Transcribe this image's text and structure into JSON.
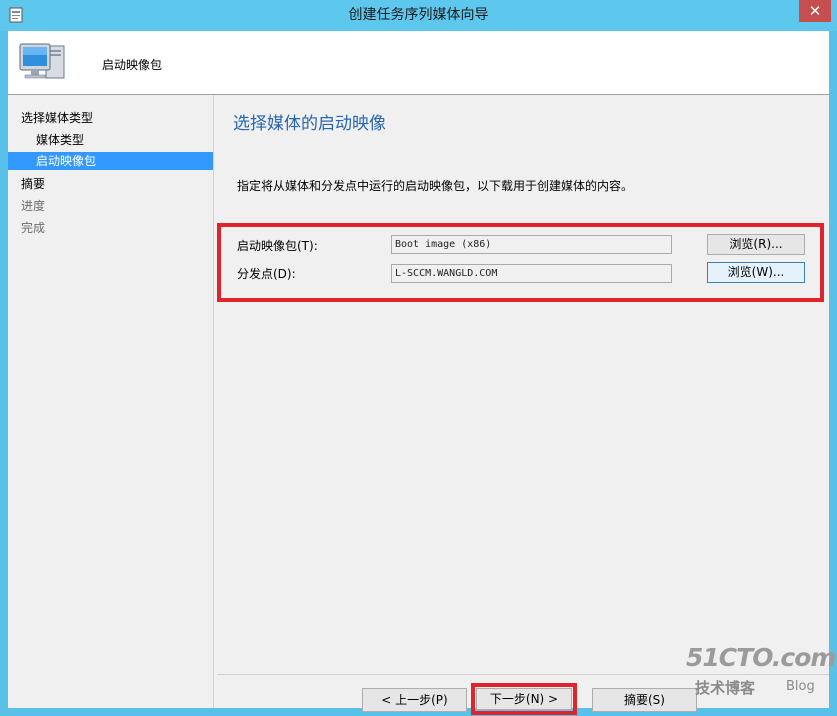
{
  "window": {
    "title": "创建任务序列媒体向导",
    "close_glyph": "✕"
  },
  "header": {
    "title": "启动映像包",
    "icon": "computer-icon"
  },
  "sidebar": {
    "items": [
      {
        "label": "选择媒体类型",
        "state": "normal"
      },
      {
        "label": "媒体类型",
        "state": "normal"
      },
      {
        "label": "启动映像包",
        "state": "active"
      },
      {
        "label": "摘要",
        "state": "normal"
      },
      {
        "label": "进度",
        "state": "disabled"
      },
      {
        "label": "完成",
        "state": "disabled"
      }
    ]
  },
  "main": {
    "page_title": "选择媒体的启动映像",
    "description": "指定将从媒体和分发点中运行的启动映像包，以下载用于创建媒体的内容。",
    "boot_image": {
      "label": "启动映像包(T):",
      "value": "Boot image (x86)",
      "browse_label": "浏览(R)..."
    },
    "distribution_point": {
      "label": "分发点(D):",
      "value": "L-SCCM.WANGLD.COM",
      "browse_label": "浏览(W)..."
    }
  },
  "footer": {
    "prev_label": "< 上一步(P)",
    "next_label": "下一步(N) >",
    "summary_label": "摘要(S)"
  },
  "watermark": {
    "main": "51CTO.com",
    "sub": "技术博客",
    "blog": "Blog"
  },
  "colors": {
    "title_bar": "#5ec7ed",
    "highlight": "#3399ff",
    "page_title": "#2766b0",
    "annotation_red": "#e0242b"
  }
}
